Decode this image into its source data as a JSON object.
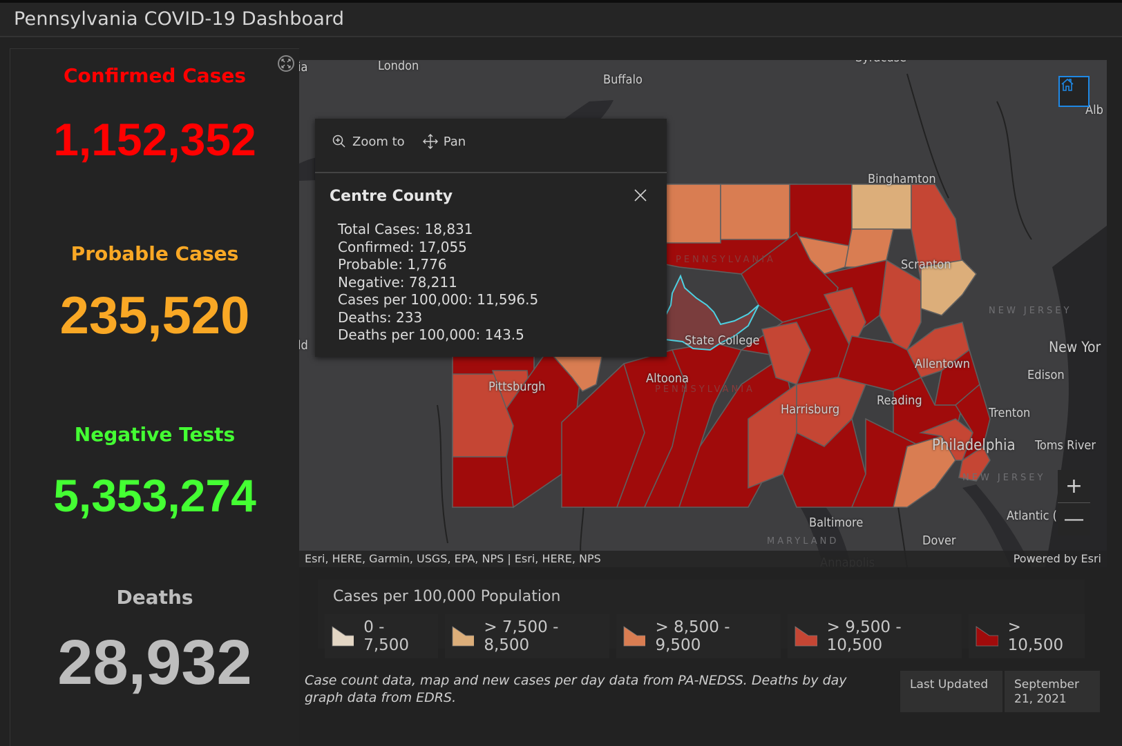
{
  "header": {
    "title": "Pennsylvania COVID-19 Dashboard"
  },
  "stats": [
    {
      "label": "Confirmed Cases",
      "value": "1,152,352",
      "color": "#ff0000"
    },
    {
      "label": "Probable Cases",
      "value": "235,520",
      "color": "#f9a825"
    },
    {
      "label": "Negative Tests",
      "value": "5,353,274",
      "color": "#44ff33"
    },
    {
      "label": "Deaths",
      "value": "28,932",
      "color": "#bdbdbd"
    }
  ],
  "map": {
    "places": {
      "london": "London",
      "buffalo": "Buffalo",
      "syracuse": "Syracuse",
      "albany": "Alb",
      "binghamton": "Binghamton",
      "scranton": "Scranton",
      "state_college": "State College",
      "allentown": "Allentown",
      "new_york": "New Yor",
      "edison": "Edison",
      "pittsburgh": "Pittsburgh",
      "altoona": "Altoona",
      "harrisburg": "Harrisburg",
      "reading": "Reading",
      "trenton": "Trenton",
      "philadelphia": "Philadelphia",
      "toms_river": "Toms River",
      "atlantic": "Atlantic (",
      "baltimore": "Baltimore",
      "dover": "Dover",
      "annapolis": "Annapolis",
      "left_cut_top": "ia",
      "left_cut_mid": "ld"
    },
    "regions": {
      "new_jersey_1": "NEW JERSEY",
      "new_jersey_2": "NEW JERSEY",
      "maryland": "MARYLAND",
      "pennsylvania_1": "PENNSYLVANIA",
      "pennsylvania_2": "PENNSYLVANIA"
    },
    "attribution_left": "Esri, HERE, Garmin, USGS, EPA, NPS | Esri, HERE, NPS",
    "attribution_right": "Powered by Esri",
    "zoom_in": "+",
    "zoom_out": "—"
  },
  "popup": {
    "zoom_to_label": "Zoom to",
    "pan_label": "Pan",
    "title": "Centre County",
    "fields": [
      "Total Cases: 18,831",
      "Confirmed: 17,055",
      "Probable: 1,776",
      "Negative: 78,211",
      "Cases per 100,000: 11,596.5",
      "Deaths: 233",
      "Deaths per 100,000: 143.5"
    ]
  },
  "legend": {
    "title": "Cases per 100,000 Population",
    "items": [
      {
        "label": "0 - 7,500",
        "color": "#e3d6c4"
      },
      {
        "label": "> 7,500 - 8,500",
        "color": "#dcae7a"
      },
      {
        "label": "> 8,500 - 9,500",
        "color": "#d97d52"
      },
      {
        "label": "> 9,500 - 10,500",
        "color": "#c54634"
      },
      {
        "label": "> 10,500",
        "color": "#a00b0b"
      }
    ]
  },
  "footer": {
    "note": "Case count data, map and new cases per day data from PA-NEDSS.  Deaths by day graph data from EDRS.",
    "last_updated_label": "Last Updated",
    "last_updated_value": "September 21, 2021"
  },
  "colors": {
    "highlight": "#4dd0e1",
    "selected_fill": "#7a3d3d",
    "accent": "#1e88e5"
  }
}
